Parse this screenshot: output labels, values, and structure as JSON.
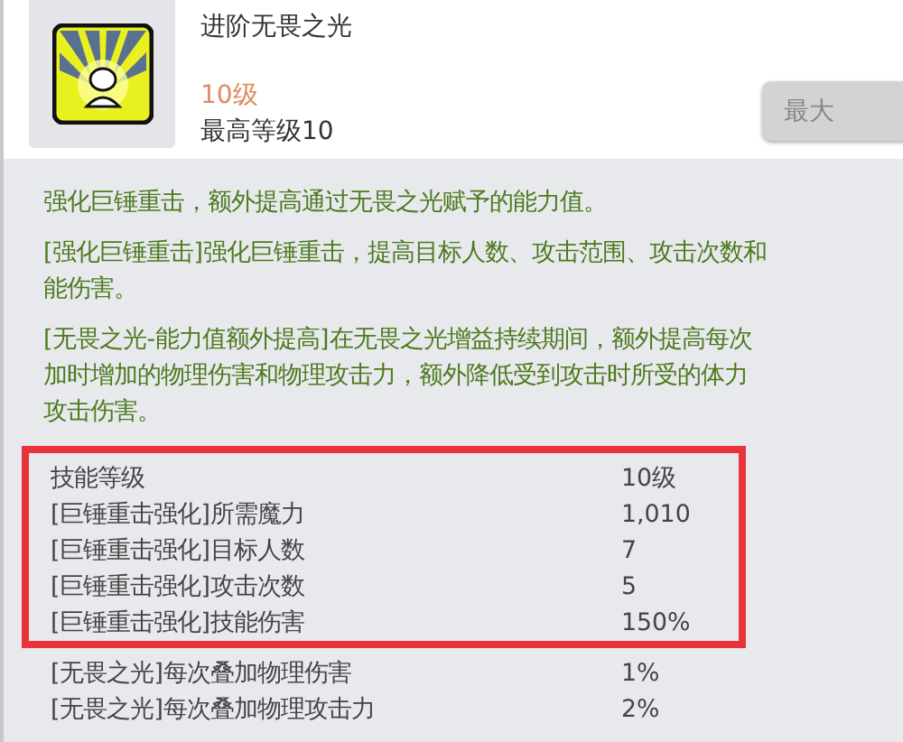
{
  "skill": {
    "name": "进阶无畏之光",
    "level": "10级",
    "max_level": "最高等级10",
    "button": {
      "label": "最大",
      "disabled": true
    }
  },
  "description": [
    {
      "lines": [
        "强化巨锤重击，额外提高通过无畏之光赋予的能力值。"
      ]
    },
    {
      "lines": [
        "[强化巨锤重击]强化巨锤重击，提高目标人数、攻击范围、攻击次数和",
        "能伤害。"
      ]
    },
    {
      "lines": [
        "[无畏之光-能力值额外提高]在无畏之光增益持续期间，额外提高每次",
        "加时增加的物理伤害和物理攻击力，额外降低受到攻击时所受的体力",
        "攻击伤害。"
      ]
    }
  ],
  "stats": [
    {
      "name": "技能等级",
      "value": "10级",
      "highlighted": true
    },
    {
      "name": "[巨锤重击强化]所需魔力",
      "value": "1,010",
      "highlighted": true
    },
    {
      "name": "[巨锤重击强化]目标人数",
      "value": "7",
      "highlighted": true
    },
    {
      "name": "[巨锤重击强化]攻击次数",
      "value": "5",
      "highlighted": true
    },
    {
      "name": "[巨锤重击强化]技能伤害",
      "value": "150%",
      "highlighted": true
    },
    {
      "name": "[无畏之光]每次叠加物理伤害",
      "value": "1%",
      "highlighted": false
    },
    {
      "name": "[无畏之光]每次叠加物理攻击力",
      "value": "2%",
      "highlighted": false
    }
  ]
}
